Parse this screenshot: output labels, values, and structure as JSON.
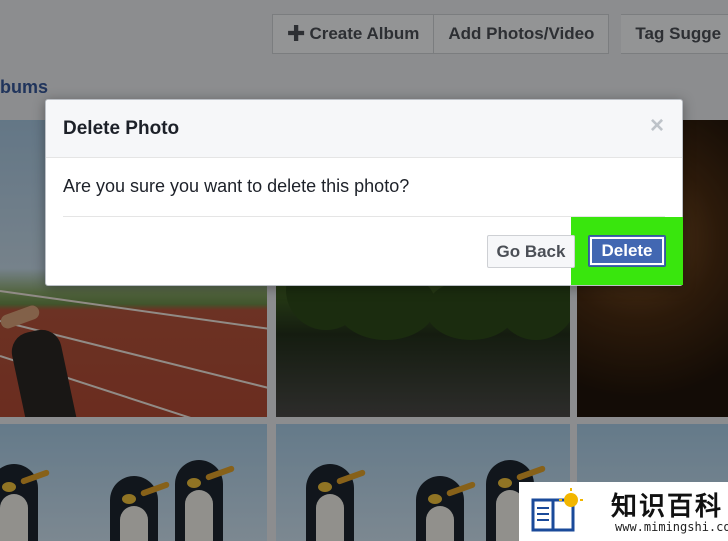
{
  "toolbar": {
    "create_album_label": "Create Album",
    "add_photos_label": "Add Photos/Video",
    "tag_suggestions_label": "Tag Sugge"
  },
  "albums_link": "bums",
  "dialog": {
    "title": "Delete Photo",
    "close_glyph": "×",
    "message": "Are you sure you want to delete this photo?",
    "go_back_label": "Go Back",
    "delete_label": "Delete",
    "highlight_color": "#39e60d",
    "primary_color": "#4267b2"
  },
  "watermark": {
    "chinese_text": "知识百科",
    "url_text": "www.mimingshi.com"
  }
}
